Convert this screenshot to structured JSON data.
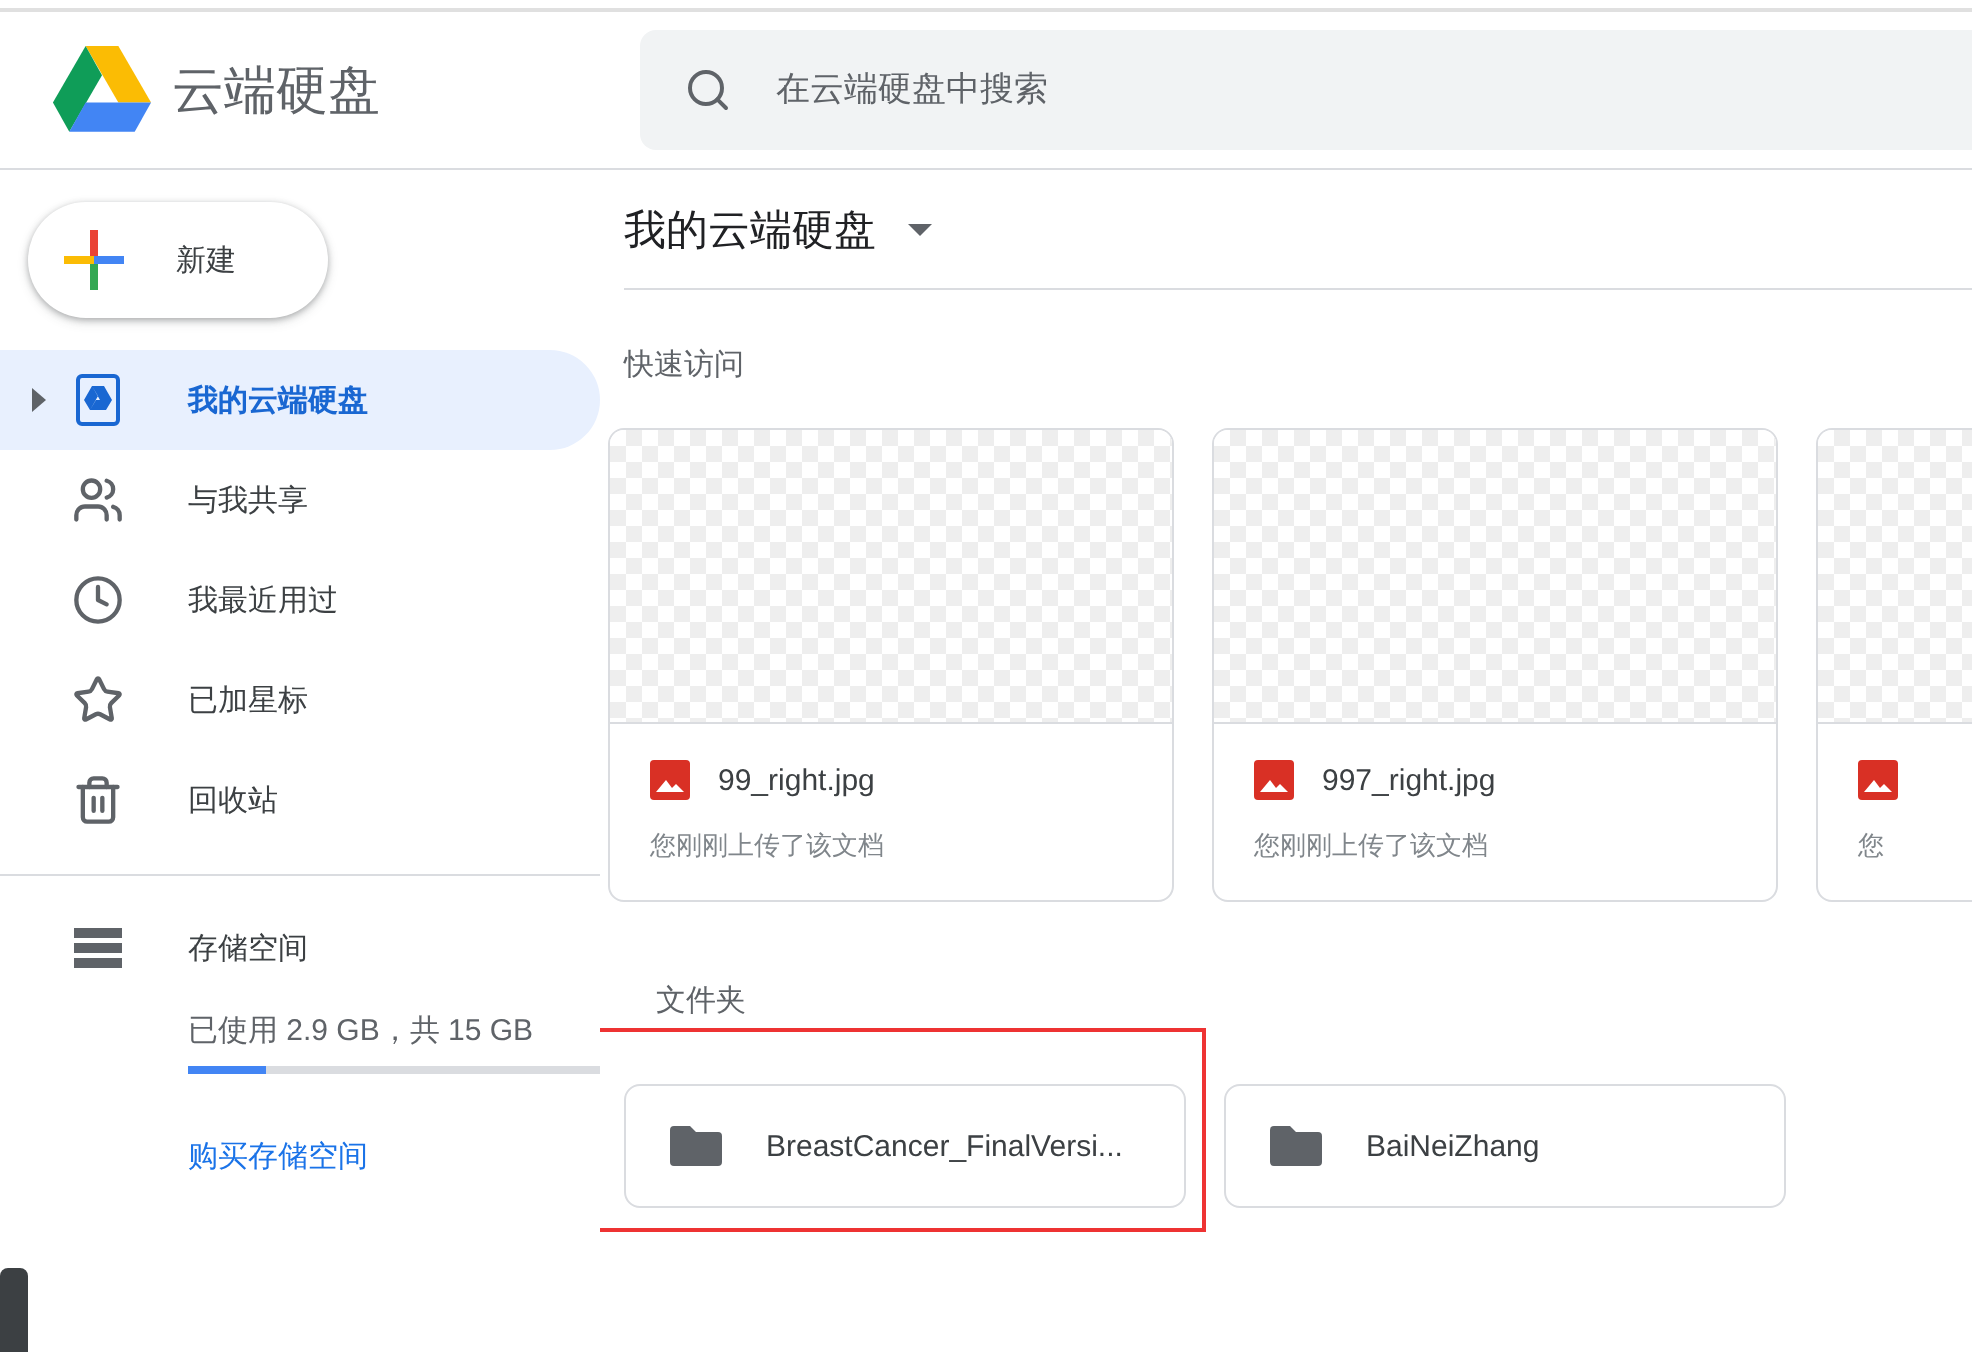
{
  "header": {
    "app_name": "云端硬盘",
    "search": {
      "placeholder": "在云端硬盘中搜索"
    }
  },
  "sidebar": {
    "new_button": "新建",
    "items": [
      {
        "kind": "drive",
        "label": "我的云端硬盘",
        "selected": true
      },
      {
        "kind": "shared",
        "label": "与我共享",
        "selected": false
      },
      {
        "kind": "recent",
        "label": "我最近用过",
        "selected": false
      },
      {
        "kind": "starred",
        "label": "已加星标",
        "selected": false
      },
      {
        "kind": "trash",
        "label": "回收站",
        "selected": false
      }
    ],
    "storage": {
      "label": "存储空间",
      "usage": "已使用 2.9 GB，共 15 GB",
      "level": 0.19,
      "buy_link": "购买存储空间"
    }
  },
  "main": {
    "title": "我的云端硬盘",
    "quick_access": {
      "heading": "快速访问",
      "files": [
        {
          "name": "99_right.jpg",
          "subtitle": "您刚刚上传了该文档"
        },
        {
          "name": "997_right.jpg",
          "subtitle": "您刚刚上传了该文档"
        },
        {
          "subtitle": "您"
        }
      ]
    },
    "folders": {
      "heading": "文件夹",
      "items": [
        {
          "name": "BreastCancer_FinalVersi...",
          "highlighted": true
        },
        {
          "name": "BaiNeiZhang",
          "highlighted": false
        }
      ]
    }
  }
}
